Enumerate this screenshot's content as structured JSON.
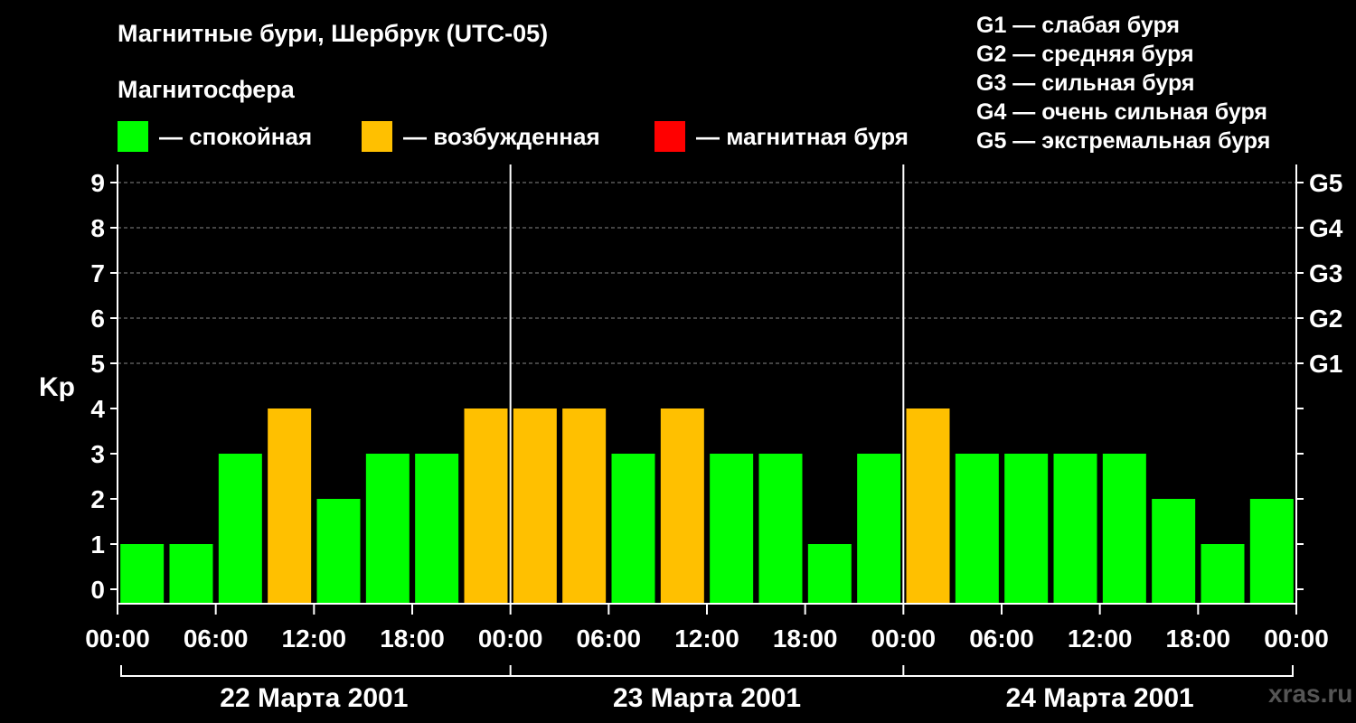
{
  "header": {
    "title": "Магнитные бури, Шербрук (UTC-05)",
    "magnetosphere_label": "Магнитосфера"
  },
  "legend": [
    {
      "label": "— спокойная",
      "color": "#00ff00"
    },
    {
      "label": "— возбужденная",
      "color": "#ffc000"
    },
    {
      "label": "— магнитная буря",
      "color": "#ff0000"
    }
  ],
  "storm_levels": [
    "G1 — слабая буря",
    "G2 — средняя буря",
    "G3 — сильная буря",
    "G4 — очень сильная буря",
    "G5 — экстремальная буря"
  ],
  "watermark": "xras.ru",
  "chart_data": {
    "type": "bar",
    "ylabel": "Kp",
    "ylim": [
      0,
      9
    ],
    "yticks": [
      "0",
      "1",
      "2",
      "3",
      "4",
      "5",
      "6",
      "7",
      "8",
      "9"
    ],
    "right_ticks": [
      {
        "kp": 5,
        "label": "G1"
      },
      {
        "kp": 6,
        "label": "G2"
      },
      {
        "kp": 7,
        "label": "G3"
      },
      {
        "kp": 8,
        "label": "G4"
      },
      {
        "kp": 9,
        "label": "G5"
      }
    ],
    "xticks": [
      "00:00",
      "06:00",
      "12:00",
      "18:00",
      "00:00",
      "06:00",
      "12:00",
      "18:00",
      "00:00",
      "06:00",
      "12:00",
      "18:00",
      "00:00"
    ],
    "days": [
      "22 Марта 2001",
      "23 Марта 2001",
      "24 Марта 2001"
    ],
    "grid": true,
    "values": [
      1,
      1,
      3,
      4,
      2,
      3,
      3,
      4,
      4,
      4,
      3,
      4,
      3,
      3,
      1,
      3,
      4,
      3,
      3,
      3,
      3,
      2,
      1,
      2
    ],
    "colors": {
      "quiet": "#00ff00",
      "active": "#ffc000",
      "storm": "#ff0000"
    }
  }
}
